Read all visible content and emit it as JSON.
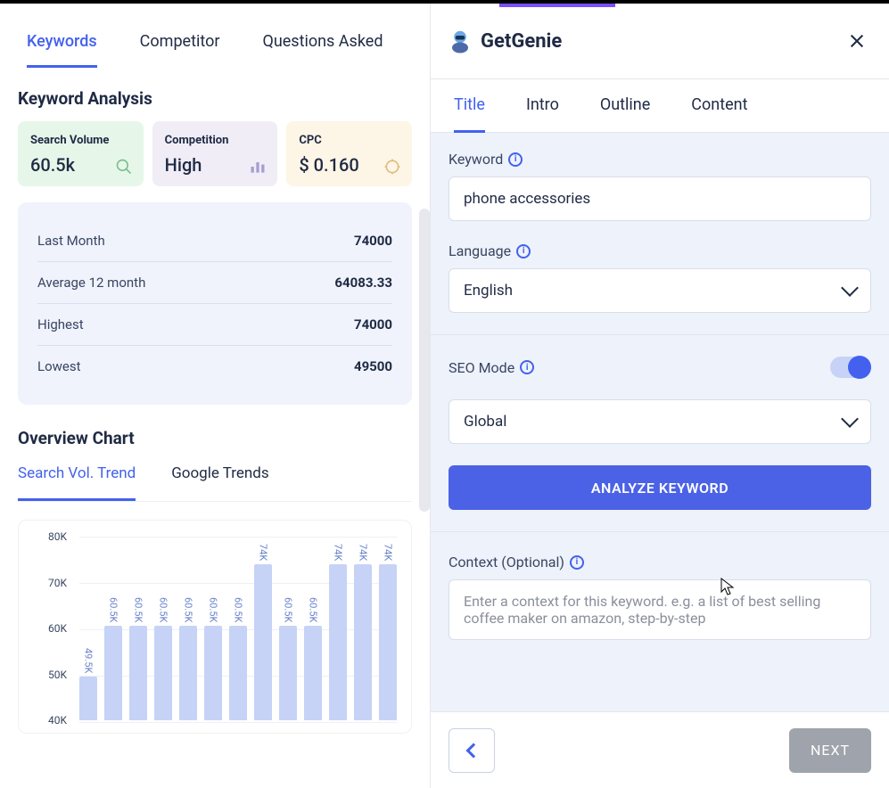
{
  "brand": {
    "name": "GetGenie"
  },
  "left_tabs": [
    "Keywords",
    "Competitor",
    "Questions Asked"
  ],
  "left_active": 0,
  "section_title": "Keyword Analysis",
  "cards": {
    "search_volume": {
      "label": "Search Volume",
      "value": "60.5k"
    },
    "competition": {
      "label": "Competition",
      "value": "High"
    },
    "cpc": {
      "label": "CPC",
      "value": "$ 0.160"
    }
  },
  "stats": [
    {
      "label": "Last Month",
      "value": "74000"
    },
    {
      "label": "Average 12 month",
      "value": "64083.33"
    },
    {
      "label": "Highest",
      "value": "74000"
    },
    {
      "label": "Lowest",
      "value": "49500"
    }
  ],
  "overview_title": "Overview Chart",
  "trend_tabs": [
    "Search Vol. Trend",
    "Google Trends"
  ],
  "trend_active": 0,
  "chart_data": {
    "type": "bar",
    "y_ticks": [
      "80K",
      "70K",
      "60K",
      "50K",
      "40K"
    ],
    "y_min": 40,
    "y_max": 80,
    "values_k": [
      49.5,
      60.5,
      60.5,
      60.5,
      60.5,
      60.5,
      60.5,
      74,
      60.5,
      60.5,
      74,
      74,
      74
    ],
    "labels": [
      "49.5K",
      "60.5K",
      "60.5K",
      "60.5K",
      "60.5K",
      "60.5K",
      "60.5K",
      "74K",
      "60.5K",
      "60.5K",
      "74K",
      "74K",
      "74K"
    ],
    "title": "",
    "xlabel": "",
    "ylabel": ""
  },
  "right_tabs": [
    "Title",
    "Intro",
    "Outline",
    "Content"
  ],
  "right_active": 0,
  "form": {
    "keyword_label": "Keyword",
    "keyword_value": "phone accessories",
    "language_label": "Language",
    "language_value": "English",
    "seo_label": "SEO Mode",
    "seo_on": true,
    "region_value": "Global",
    "analyze_btn": "ANALYZE KEYWORD",
    "context_label": "Context (Optional)",
    "context_placeholder": "Enter a context for this keyword. e.g. a list of best selling coffee maker on amazon, step-by-step"
  },
  "footer": {
    "next": "NEXT"
  }
}
